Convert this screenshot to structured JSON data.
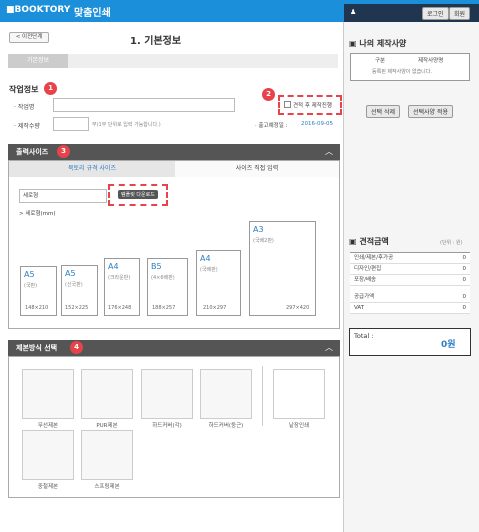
{
  "header": {
    "brand": "■BOOKTORY",
    "title": "맞춤인쇄",
    "user_icon": "user-icon",
    "login": "로그인",
    "join": "회원"
  },
  "nav": {
    "back": "< 이전단계",
    "page_title": "1. 기본정보",
    "step_tab": "기본정보"
  },
  "work": {
    "section": "작업정보",
    "name_label": "· 작업명",
    "qty_label": "· 제작수량",
    "qty_unit": "부(1부 단위로 입력 가능합니다.)",
    "checkbox": "견적 후 제작진행",
    "release_label": "· 출고예정일 :",
    "release_date": "2016-09-05"
  },
  "output": {
    "title": "출력사이즈",
    "tab1": "북토리 규격 사이즈",
    "tab2": "사이즈 직접 입력",
    "select": "세로형",
    "template_btn": "템플릿 다운로드",
    "orientation": "> 세로형(mm)",
    "papers": [
      {
        "name": "A5",
        "sub": "(국판)",
        "dim": "148×210"
      },
      {
        "name": "A5",
        "sub": "(신국판)",
        "dim": "152×225"
      },
      {
        "name": "A4",
        "sub": "(크라운판)",
        "dim": "176×248"
      },
      {
        "name": "B5",
        "sub": "(4×6배판)",
        "dim": "188×257"
      },
      {
        "name": "A4",
        "sub": "(국배판)",
        "dim": "210×297"
      },
      {
        "name": "A3",
        "sub": "(국배2판)",
        "dim": "297×420"
      }
    ]
  },
  "binding": {
    "title": "제본방식 선택",
    "items": [
      "무선제본",
      "PUR제본",
      "하드커버(각)",
      "하드커버(둥근)",
      "낱장인쇄",
      "중철제본",
      "스프링제본"
    ]
  },
  "side": {
    "my_title": "나의 제작사양",
    "col1": "구분",
    "col2": "제작사양명",
    "empty": "등록된 제작사양이 없습니다.",
    "del_btn": "선택 삭제",
    "apply_btn": "선택사양 적용",
    "est_title": "견적금액",
    "unit": "(단위 : 원)",
    "rows": [
      {
        "k": "인쇄/제본/후가공",
        "v": "0"
      },
      {
        "k": "디자인/편집",
        "v": "0"
      },
      {
        "k": "포장/배송",
        "v": "0"
      },
      {
        "k": "공급가액",
        "v": "0"
      },
      {
        "k": "VAT",
        "v": "0"
      }
    ],
    "total_label": "Total :",
    "total": "0원"
  },
  "badges": [
    "1",
    "2",
    "3",
    "4"
  ]
}
